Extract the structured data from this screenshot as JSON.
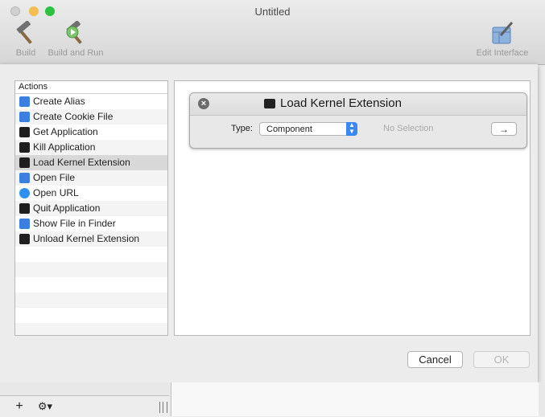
{
  "window": {
    "title": "Untitled"
  },
  "toolbar": {
    "build_label": "Build",
    "build_and_run_label": "Build and Run",
    "edit_interface_label": "Edit Interface"
  },
  "actions": {
    "header": "Actions",
    "items": [
      {
        "label": "Create Alias",
        "icon": "finder-icon"
      },
      {
        "label": "Create Cookie File",
        "icon": "finder-icon"
      },
      {
        "label": "Get Application",
        "icon": "activity-monitor-icon"
      },
      {
        "label": "Kill Application",
        "icon": "activity-monitor-icon"
      },
      {
        "label": "Load Kernel Extension",
        "icon": "terminal-icon",
        "selected": true
      },
      {
        "label": "Open File",
        "icon": "finder-icon"
      },
      {
        "label": "Open URL",
        "icon": "safari-icon"
      },
      {
        "label": "Quit Application",
        "icon": "activity-monitor-icon"
      },
      {
        "label": "Show File in Finder",
        "icon": "finder-icon"
      },
      {
        "label": "Unload Kernel Extension",
        "icon": "terminal-icon"
      }
    ]
  },
  "card": {
    "title": "Load Kernel Extension",
    "type_label": "Type:",
    "type_value": "Component",
    "no_selection": "No Selection",
    "arrow": "→"
  },
  "dialog": {
    "cancel_label": "Cancel",
    "ok_label": "OK"
  },
  "bottom": {
    "add_symbol": "+",
    "gear_symbol": "⚙▾"
  },
  "colors": {
    "accent": "#3b87f3",
    "selected_row": "#d8d8d8"
  }
}
